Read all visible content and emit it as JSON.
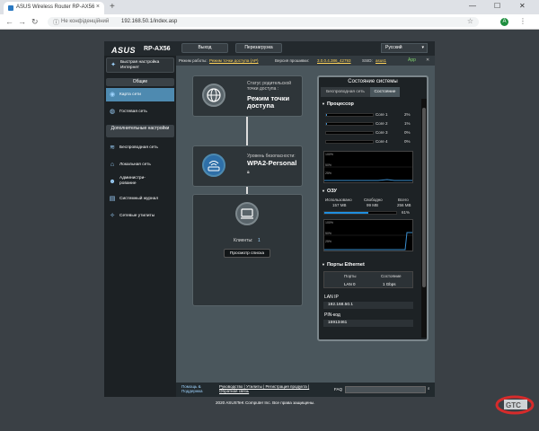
{
  "browser": {
    "tab_title": "ASUS Wireless Router RP-AX56",
    "tab_close": "×",
    "new_tab": "+",
    "not_secure": "Не конфіденційний",
    "url": "192.168.50.1/index.asp",
    "avatar_letter": "A"
  },
  "router": {
    "brand": "ASUS",
    "model": "RP-AX56",
    "top_buttons": [
      "Выход",
      "Перезагрузка"
    ],
    "language": "Русский",
    "info": {
      "mode_label": "Режим работы:",
      "mode_value": "Режим точки доступа (AP)",
      "fw_label": "Версия прошивки:",
      "fw_value": "3.0.0.4.386_42793",
      "ssid_label": "SSID:",
      "ssid_value": "asus1",
      "app": "App"
    },
    "sidebar": {
      "quick_setup": "Быстрая настройка Интернет",
      "general_head": "Общие",
      "general_items": [
        "Карта сети",
        "Гостевая сеть"
      ],
      "advanced_head": "Дополнительные настройки",
      "advanced_items": [
        "Беспроводная сеть",
        "Локальная сеть",
        "Администри-рование",
        "Системный журнал",
        "Сетевые утилиты"
      ]
    },
    "map": {
      "parent_status_label": "Статус родительской точки доступа :",
      "parent_status_value": "Режим точки доступа",
      "security_label": "Уровень безопасности:",
      "security_value": "WPA2-Personal",
      "clients_label": "Клиенты:",
      "clients_value": "1",
      "view_list": "Просмотр списка"
    },
    "status": {
      "title": "Состояние системы",
      "tabs": [
        "Беспроводная сеть",
        "Состояние"
      ],
      "cpu_title": "Процессор",
      "cores": [
        {
          "label": "Core 1",
          "percent": 2,
          "text": "2%"
        },
        {
          "label": "Core 2",
          "percent": 1,
          "text": "1%"
        },
        {
          "label": "Core 3",
          "percent": 0,
          "text": "0%"
        },
        {
          "label": "Core 4",
          "percent": 0,
          "text": "0%"
        }
      ],
      "graph_ticks": [
        "100%",
        "50%",
        "25%"
      ],
      "ram_title": "ОЗУ",
      "ram_labels": [
        "Использовано",
        "Свободно",
        "Всего"
      ],
      "ram_values": [
        "157 MB",
        "99 MB",
        "256 MB"
      ],
      "ram_percent": 61,
      "ram_percent_text": "61%",
      "eth_title": "Порты Ethernet",
      "eth_cols": [
        "Порты",
        "Состояние"
      ],
      "eth_row": [
        "LAN 0",
        "1 Gbps"
      ],
      "lan_ip_label": "LAN IP",
      "lan_ip_value": "192.168.50.1",
      "pin_label": "PIN-код",
      "pin_value": "15913461"
    },
    "footer": {
      "help": "Помощь & Поддержка",
      "links": "Руководство | Утилиты | Регистрация продукта | Обратная связь",
      "faq": "FAQ"
    },
    "copyright": "2020 ASUSTeK Computer Inc. Все права защищены."
  },
  "colors": {
    "page_bg": "#3a4045",
    "panel_dark": "#23292d",
    "main_bg": "#4a565c",
    "highlight_blue": "#4e8ab0",
    "cpu_graph": "#3a8fd0",
    "ram_bar": "#1f8fe0",
    "fw_link": "#ffd35a",
    "watermark_red": "#d62b2b"
  }
}
